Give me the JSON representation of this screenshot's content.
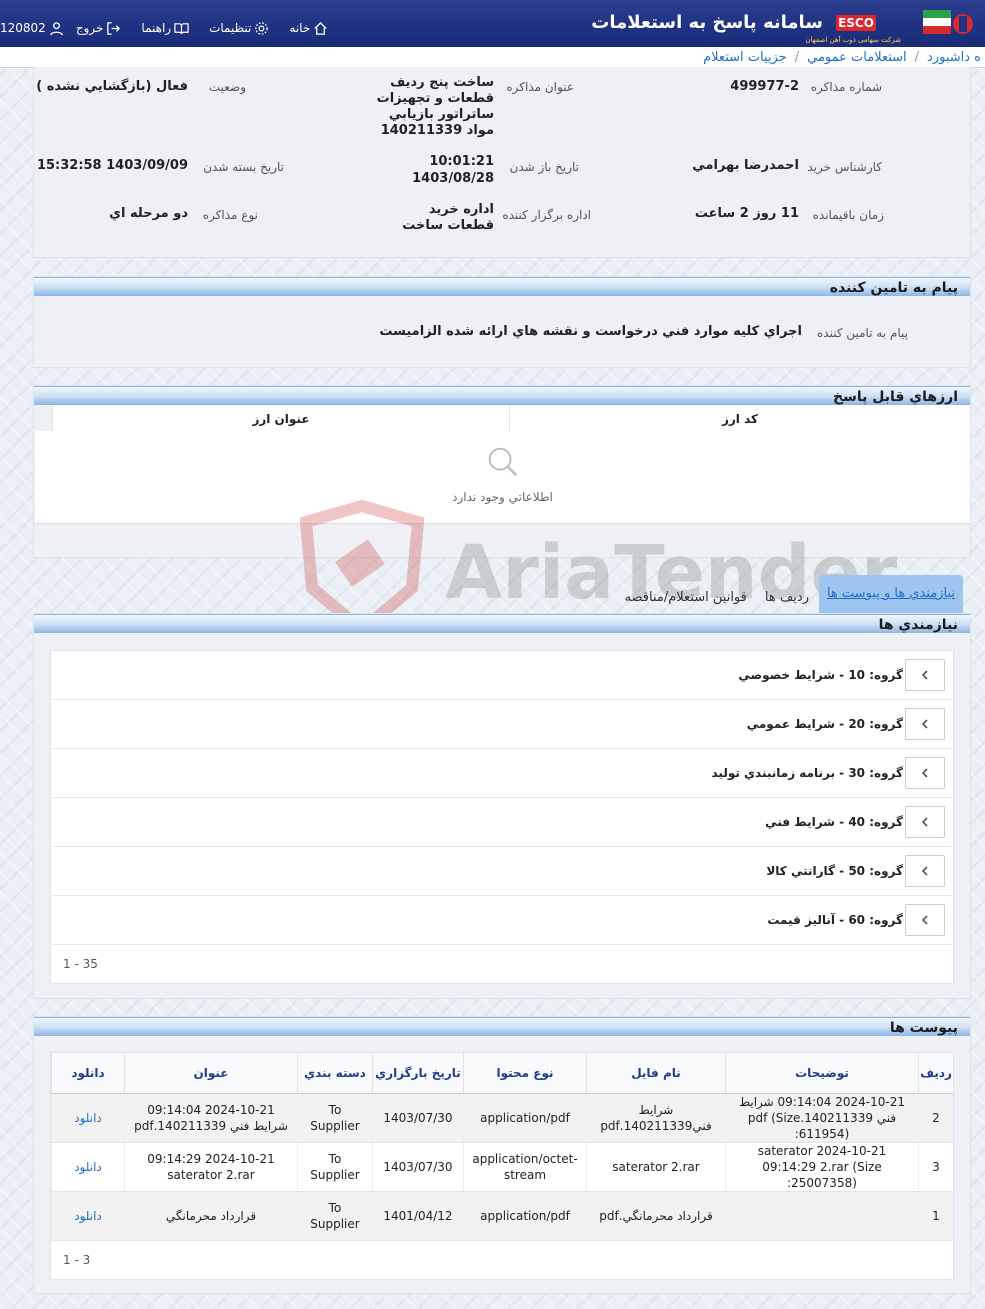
{
  "header": {
    "title": "سامانه پاسخ به استعلامات",
    "logo_text": "ESCO",
    "logo_subtitle": "شرکت سهامی ذوب آهن اصفهان",
    "user_code": "120802",
    "nav": {
      "exit": "خروج",
      "guide": "راهنما",
      "settings": "تنظیمات",
      "home": "خانه"
    }
  },
  "breadcrumb": [
    "ه داشبورد",
    "استعلامات عمومي",
    "جزييات استعلام"
  ],
  "details": {
    "tender_no_label": "شماره مذاکره",
    "tender_no": "499977-2",
    "subject_label": "عنوان مذاکره",
    "subject": "ساخت پنج رديف قطعات و تجهيزات ساتراتور بازيابي مواد 140211339",
    "status_label": "وضعيت",
    "status": "فعال (بازگشايي نشده )",
    "buyer_label": "کارشناس خريد",
    "buyer": "احمدرضا بهرامي",
    "open_label": "تاريخ باز شدن",
    "open_time": "10:01:21",
    "open_date": "1403/08/28",
    "close_label": "تاريخ بسته شدن",
    "close": "1403/09/09 15:32:58",
    "remaining_label": "زمان باقيمانده",
    "remaining": "11 روز 2 ساعت",
    "org_label": "اداره برگزار کننده",
    "org": "اداره خريد قطعات ساخت",
    "type_label": "نوع مذاکره",
    "type": "دو مرحله اي"
  },
  "message": {
    "heading": "پيام به تامين کننده",
    "label": "پيام به تامين کننده",
    "text": "اجراي کليه موارد فني درخواست و نقشه هاي ارائه شده الزاميست"
  },
  "currencies": {
    "heading": "ارزهاي قابل پاسخ",
    "col_code": "کد ارز",
    "col_title": "عنوان ارز",
    "empty": "اطلاعاتي وجود ندارد"
  },
  "tabs": [
    "نيازمندي ها و پيوست ها",
    "رديف ها",
    "قوانين استعلام/مناقصه"
  ],
  "requirements": {
    "heading": "نيازمندي ها",
    "groups": [
      "گروه: 10 - شرايط خصوصي",
      "گروه: 20 - شرايط عمومي",
      "گروه: 30 - برنامه زمانبندي توليد",
      "گروه: 40 - شرايط فني",
      "گروه: 50 - گارانتي کالا",
      "گروه: 60 - آناليز قيمت"
    ],
    "pager": "1 - 35"
  },
  "attachments": {
    "heading": "پيوست ها",
    "columns": [
      "رديف",
      "توضيحات",
      "نام فايل",
      "نوع محتوا",
      "تاريخ بارگزاري",
      "دسته بندي",
      "عنوان",
      "دانلود"
    ],
    "rows": [
      [
        "2",
        "2024-10-21 09:14:04 شرايط فني 140211339.pdf (Size :611954)",
        "شرايط فني140211339.pdf",
        "application/pdf",
        "1403/07/30",
        "To Supplier",
        "2024-10-21 09:14:04 شرايط فني 140211339.pdf",
        "دانلود"
      ],
      [
        "3",
        "saterator 2024-10-21 09:14:29 2.rar (Size :25007358)",
        "saterator 2.rar",
        "application/octet-stream",
        "1403/07/30",
        "To Supplier",
        "2024-10-21 09:14:29 saterator 2.rar",
        "دانلود"
      ],
      [
        "1",
        "",
        "قرارداد محرمانگي.pdf",
        "application/pdf",
        "1401/04/12",
        "To Supplier",
        "قرارداد محرمانگي",
        "دانلود"
      ]
    ],
    "pager": "1 - 3"
  },
  "watermark": "AriaTender.neT"
}
